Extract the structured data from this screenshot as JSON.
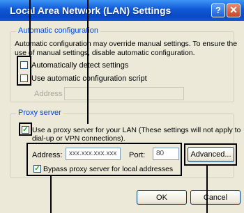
{
  "window": {
    "title": "Local Area Network (LAN) Settings",
    "help_glyph": "?",
    "close_glyph": "✕"
  },
  "auto_config": {
    "group_title": "Automatic configuration",
    "description_line1": "Automatic configuration may override manual settings.  To ensure the",
    "description_line2": "use of manual settings, disable automatic configuration.",
    "detect_label": "Automatically detect settings",
    "detect_checked": false,
    "script_label": "Use automatic configuration script",
    "script_checked": false,
    "address_label": "Address",
    "address_value": ""
  },
  "proxy": {
    "group_title": "Proxy server",
    "use_proxy_line1": "Use a proxy server for your LAN (These settings will not apply to",
    "use_proxy_line2": "dial-up or VPN connections).",
    "use_proxy_checked": true,
    "address_label": "Address:",
    "address_value": "xxx.xxx.xxx.xxx",
    "port_label": "Port:",
    "port_value": "80",
    "advanced_label": "Advanced...",
    "bypass_label": "Bypass proxy server for local addresses",
    "bypass_checked": true,
    "check_glyph": "✓"
  },
  "footer": {
    "ok_label": "OK",
    "cancel_label": "Cancel"
  }
}
